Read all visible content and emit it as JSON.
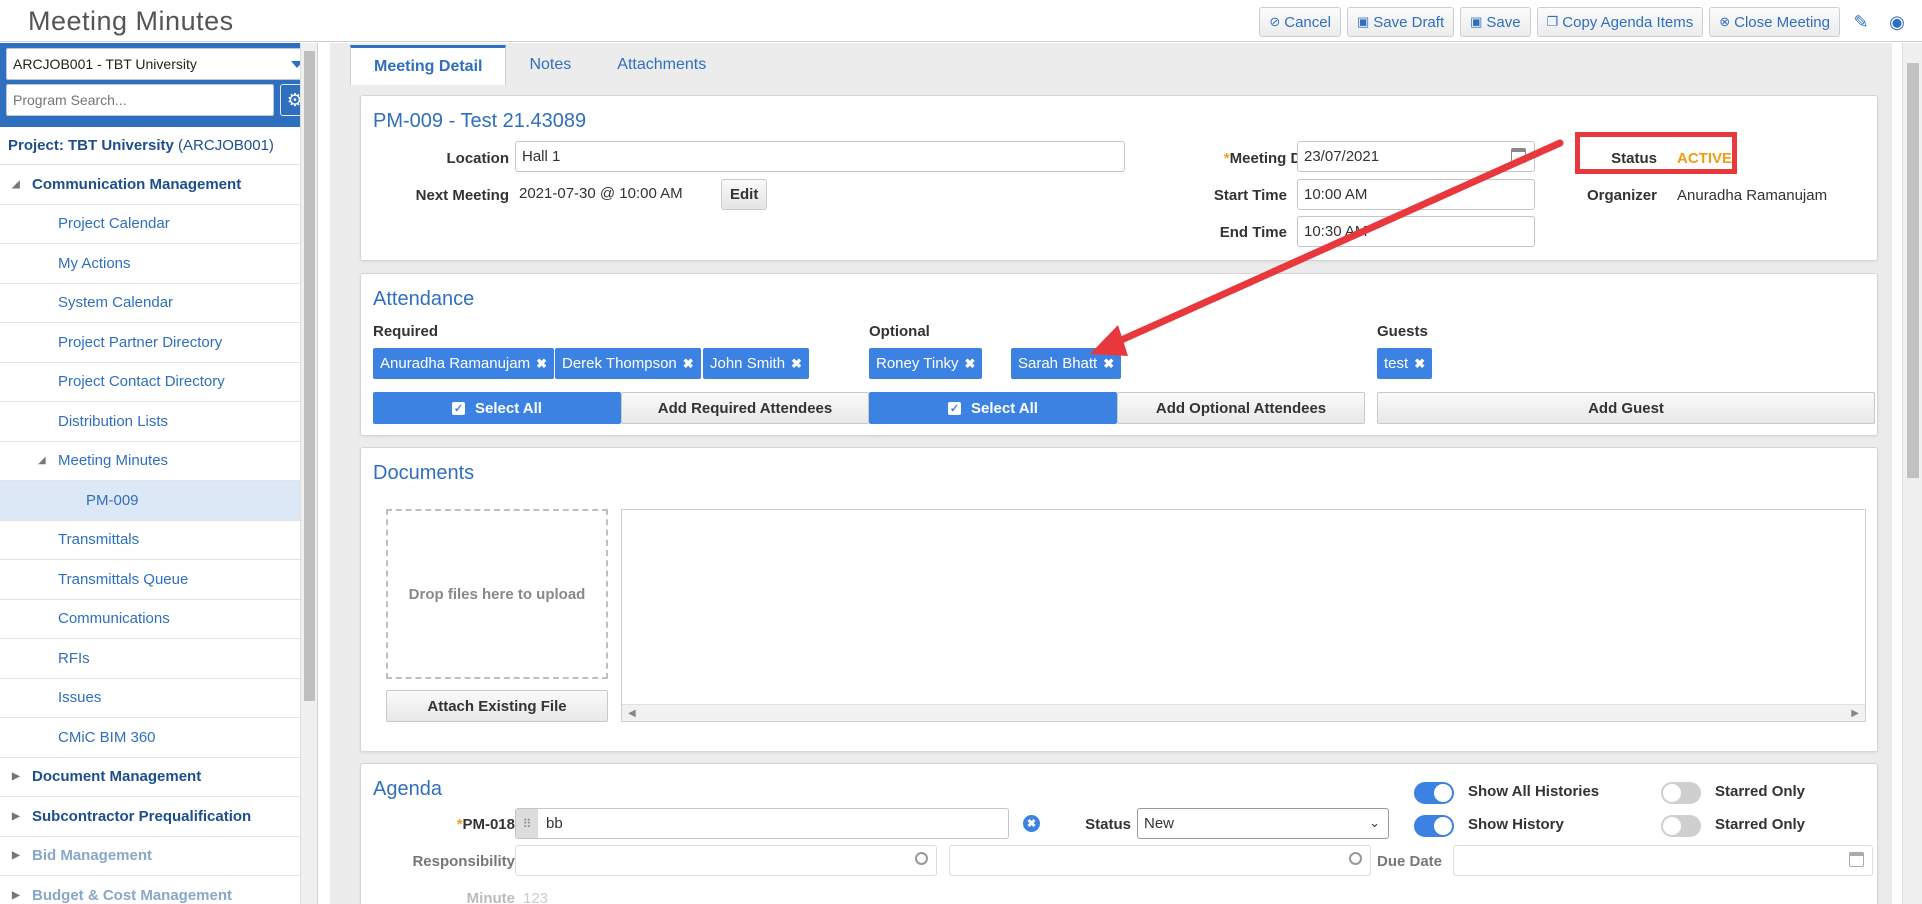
{
  "app": {
    "title": "Meeting Minutes"
  },
  "toolbar": {
    "cancel": "Cancel",
    "save_draft": "Save Draft",
    "save": "Save",
    "copy_agenda": "Copy Agenda Items",
    "close_meeting": "Close Meeting"
  },
  "sidebar": {
    "project_select": "ARCJOB001 - TBT University",
    "search_placeholder": "Program Search...",
    "project_label": "Project: TBT University",
    "project_code": "(ARCJOB001)",
    "items": [
      {
        "label": "Communication Management"
      },
      {
        "label": "Project Calendar"
      },
      {
        "label": "My Actions"
      },
      {
        "label": "System Calendar"
      },
      {
        "label": "Project Partner Directory"
      },
      {
        "label": "Project Contact Directory"
      },
      {
        "label": "Distribution Lists"
      },
      {
        "label": "Meeting Minutes"
      },
      {
        "label": "PM-009"
      },
      {
        "label": "Transmittals"
      },
      {
        "label": "Transmittals Queue"
      },
      {
        "label": "Communications"
      },
      {
        "label": "RFIs"
      },
      {
        "label": "Issues"
      },
      {
        "label": "CMiC BIM 360"
      },
      {
        "label": "Document Management"
      },
      {
        "label": "Subcontractor Prequalification"
      },
      {
        "label": "Bid Management"
      },
      {
        "label": "Budget & Cost Management"
      }
    ]
  },
  "tabs": [
    "Meeting Detail",
    "Notes",
    "Attachments"
  ],
  "detail": {
    "title": "PM-009 - Test 21.43089",
    "location_label": "Location",
    "location_value": "Hall 1",
    "next_meeting_label": "Next Meeting",
    "next_meeting_value": "2021-07-30 @ 10:00 AM",
    "edit_label": "Edit",
    "required_mark": "*",
    "meeting_date_label": "Meeting Date",
    "meeting_date_value": "23/07/2021",
    "start_time_label": "Start Time",
    "start_time_value": "10:00 AM",
    "end_time_label": "End Time",
    "end_time_value": "10:30 AM",
    "status_label": "Status",
    "status_value": "ACTIVE",
    "organizer_label": "Organizer",
    "organizer_value": "Anuradha Ramanujam"
  },
  "attendance": {
    "title": "Attendance",
    "required_label": "Required",
    "optional_label": "Optional",
    "guests_label": "Guests",
    "required": [
      "Anuradha Ramanujam",
      "Derek Thompson",
      "John Smith"
    ],
    "optional": [
      "Roney Tinky",
      "Sarah Bhatt"
    ],
    "guests": [
      "test"
    ],
    "select_all": "Select All",
    "add_required": "Add Required Attendees",
    "add_optional": "Add Optional Attendees",
    "add_guest": "Add Guest"
  },
  "documents": {
    "title": "Documents",
    "drop_text": "Drop files here to upload",
    "attach_existing": "Attach Existing File"
  },
  "agenda": {
    "title": "Agenda",
    "item_label": "PM-018",
    "item_value": "bb",
    "status_label": "Status",
    "status_value": "New",
    "show_all_histories": "Show All Histories",
    "show_history": "Show History",
    "starred_only": "Starred Only",
    "responsibility_label": "Responsibility",
    "due_date_label": "Due Date",
    "minute_label": "Minute",
    "minute_value": "123"
  },
  "colors": {
    "accent": "#2f6fc0",
    "status": "#f39c12",
    "annotation": "#e8383d"
  }
}
